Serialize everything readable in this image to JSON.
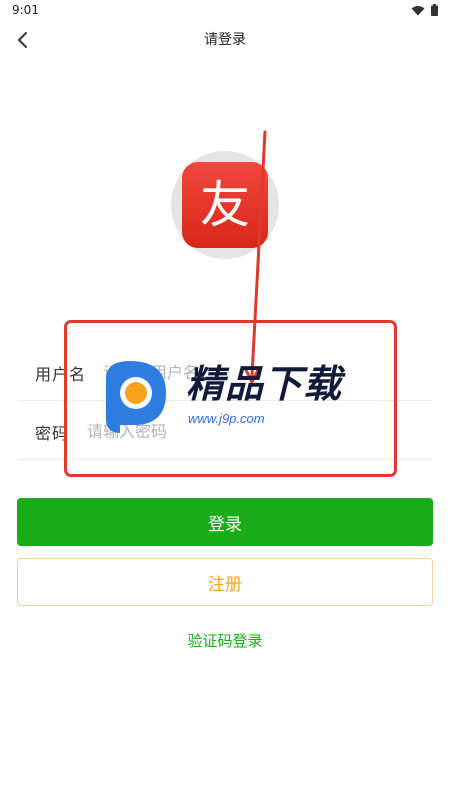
{
  "status_bar": {
    "time": "9:01"
  },
  "nav": {
    "title": "请登录"
  },
  "logo": {
    "glyph": "友"
  },
  "form": {
    "username_label": "用户名",
    "username_placeholder": "请输入用户名",
    "password_label": "密码",
    "password_placeholder": "请输入密码"
  },
  "actions": {
    "login_label": "登录",
    "register_label": "注册",
    "sms_login_label": "验证码登录"
  },
  "watermark": {
    "title": "精品下载",
    "url": "www.j9p.com"
  },
  "colors": {
    "primary_green": "#1aad19",
    "register_orange": "#f5a623",
    "annotation_red": "#e03a2c",
    "logo_red": "#e2322a"
  },
  "icons": [
    "back-arrow-icon",
    "wifi-icon",
    "battery-icon"
  ]
}
